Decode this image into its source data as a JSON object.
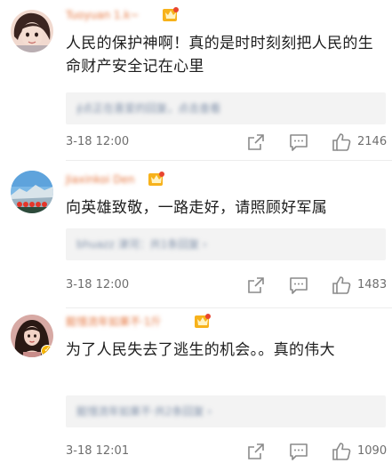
{
  "comments": [
    {
      "username": "Tuoyuan 1.k~",
      "text": "人民的保护神啊！真的是时时刻刻把人民的生命财产安全记在心里",
      "reply_preview": "∮点正在喜爱的回复，点击查看",
      "timestamp": "3-18 12:00",
      "likes": "2146"
    },
    {
      "username": "Jiaxinkoi Den",
      "text": "向英雄致敬，一路走好，请照顾好军属",
      "reply_preview": "bhuazz 津河：共1条回复 ›",
      "timestamp": "3-18 12:00",
      "likes": "1483"
    },
    {
      "username": "懿惜流年如果不·1斤",
      "text": "为了人民失去了逃生的机会。。真的伟大",
      "reply_preview": "懿惜流年如果不·共2条回复 ›",
      "timestamp": "3-18 12:01",
      "likes": "1090"
    }
  ],
  "icons": {
    "share": "share-icon",
    "comment": "comment-icon",
    "like": "like-icon",
    "vip": "vip-crown-badge"
  },
  "colors": {
    "username": "#e5763f",
    "reply_text": "#7e8fa8",
    "meta_text": "#6e6e6e",
    "icon": "#8a8a8a"
  }
}
